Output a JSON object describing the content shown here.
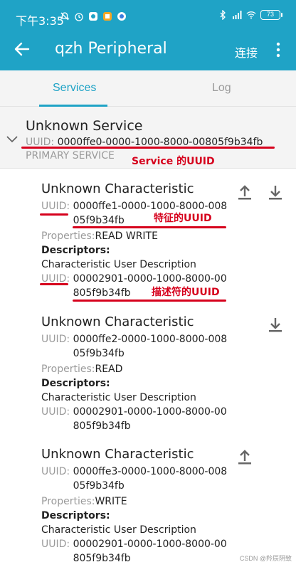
{
  "status_bar": {
    "time": "下午3:35",
    "battery": "73"
  },
  "app_bar": {
    "title": "qzh Peripheral",
    "connect_label": "连接"
  },
  "tabs": [
    {
      "label": "Services",
      "active": true
    },
    {
      "label": "Log",
      "active": false
    }
  ],
  "service": {
    "name": "Unknown Service",
    "uuid_label": "UUID: ",
    "uuid": "0000ffe0-0000-1000-8000-00805f9b34fb",
    "type": "PRIMARY SERVICE"
  },
  "characteristics": [
    {
      "name": "Unknown Characteristic",
      "uuid_label": "UUID: ",
      "uuid": "0000ffe1-0000-1000-8000-00805f9b34fb",
      "properties_label": "Properties:",
      "properties": "READ WRITE",
      "descriptors_label": "Descriptors:",
      "descriptor_name": "Characteristic User Description",
      "descriptor_uuid_label": "UUID: ",
      "descriptor_uuid": "00002901-0000-1000-8000-00805f9b34fb",
      "actions": [
        "upload-icon",
        "download-icon"
      ]
    },
    {
      "name": "Unknown Characteristic",
      "uuid_label": "UUID: ",
      "uuid": "0000ffe2-0000-1000-8000-00805f9b34fb",
      "properties_label": "Properties:",
      "properties": "READ",
      "descriptors_label": "Descriptors:",
      "descriptor_name": "Characteristic User Description",
      "descriptor_uuid_label": "UUID: ",
      "descriptor_uuid": "00002901-0000-1000-8000-00805f9b34fb",
      "actions": [
        "download-icon"
      ]
    },
    {
      "name": "Unknown Characteristic",
      "uuid_label": "UUID: ",
      "uuid": "0000ffe3-0000-1000-8000-00805f9b34fb",
      "properties_label": "Properties:",
      "properties": "WRITE",
      "descriptors_label": "Descriptors:",
      "descriptor_name": "Characteristic User Description",
      "descriptor_uuid_label": "UUID: ",
      "descriptor_uuid": "00002901-0000-1000-8000-00805f9b34fb",
      "actions": [
        "upload-icon"
      ]
    }
  ],
  "annotations": {
    "service_uuid": "Service 的UUID",
    "char_uuid": "特征的UUID",
    "descriptor_uuid": "描述符的UUID"
  },
  "watermark": "CSDN @羚辰阴致",
  "colors": {
    "accent": "#1fa3c6",
    "annotation": "#d6001c"
  }
}
